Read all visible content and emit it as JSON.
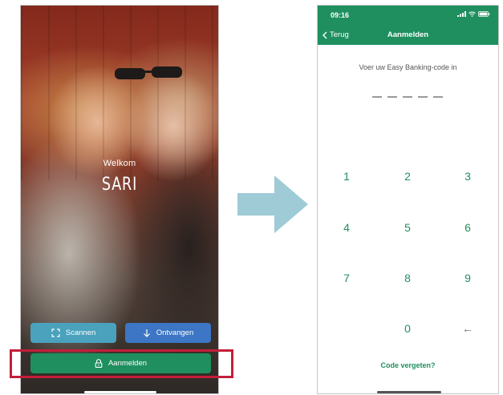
{
  "welcome_screen": {
    "greeting": "Welkom",
    "user_name": "SARI",
    "scan_button": {
      "label": "Scannen",
      "icon": "scan-frame-icon",
      "color": "#4aa2bd"
    },
    "receive_button": {
      "label": "Ontvangen",
      "icon": "arrow-down-icon",
      "color": "#3c76c5"
    },
    "login_button": {
      "label": "Aanmelden",
      "icon": "lock-icon",
      "color": "#1f8f5f"
    },
    "highlight_color": "#c41e3a"
  },
  "transition_arrow": {
    "icon": "right-arrow-icon",
    "color": "#9ecbd6"
  },
  "pin_screen": {
    "status_bar": {
      "time": "09:16"
    },
    "nav": {
      "back_label": "Terug",
      "title": "Aanmelden"
    },
    "prompt": "Voer uw Easy Banking-code in",
    "pin_length": 5,
    "keypad": [
      "1",
      "2",
      "3",
      "4",
      "5",
      "6",
      "7",
      "8",
      "9",
      "",
      "0",
      "←"
    ],
    "forgot_link": "Code vergeten?",
    "accent_color": "#1f8f5f"
  }
}
